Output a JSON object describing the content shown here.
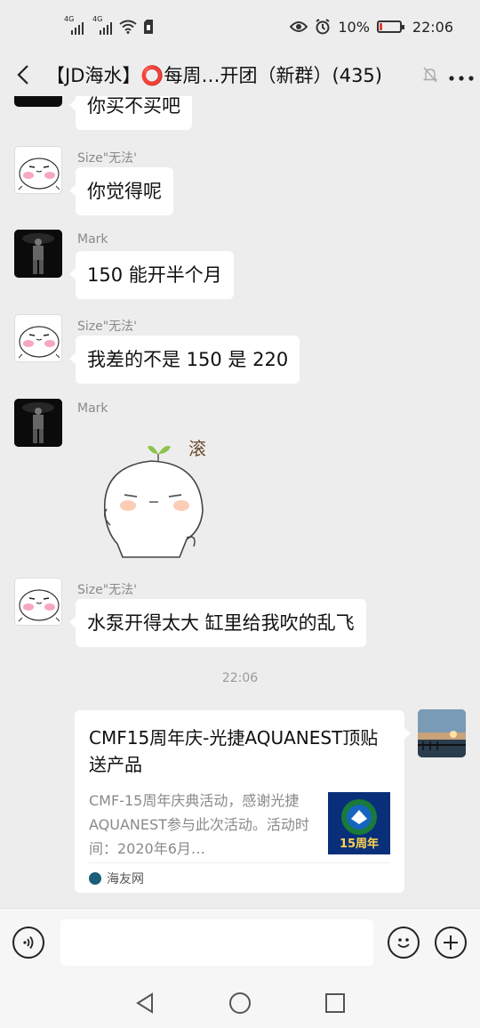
{
  "status_bar": {
    "signal1_tag": "4G",
    "signal2_tag": "4G",
    "battery_text": "10%",
    "clock": "22:06"
  },
  "header": {
    "title": "【JD海水】⭕每周…开团（新群）(435)"
  },
  "messages": [
    {
      "sender": "",
      "text": "你买不买吧"
    },
    {
      "sender": "Size\"无法'",
      "text": "你觉得呢"
    },
    {
      "sender": "Mark",
      "text": "150 能开半个月"
    },
    {
      "sender": "Size\"无法'",
      "text": "我差的不是 150 是 220"
    },
    {
      "sender": "Mark",
      "sticker_text": "滚"
    },
    {
      "sender": "Size\"无法'",
      "text": "水泵开得太大 缸里给我吹的乱飞"
    }
  ],
  "timestamp": "22:06",
  "link_card": {
    "title": "CMF15周年庆-光捷AQUANEST顶贴送产品",
    "description": "CMF-15周年庆典活动，感谢光捷AQUANEST参与此次活动。活动时间：2020年6月…",
    "thumb_text": "15周年",
    "source": "海友网"
  },
  "input": {
    "value": ""
  },
  "colors": {
    "background": "#ededed",
    "bubble": "#ffffff",
    "battery_low": "#e53935"
  }
}
